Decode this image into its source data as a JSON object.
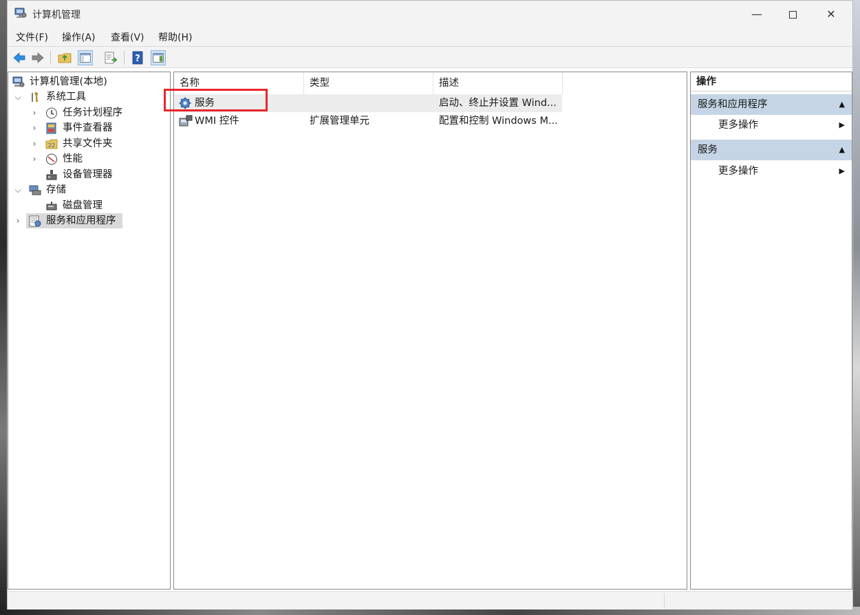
{
  "window": {
    "title": "计算机管理"
  },
  "menu": [
    "文件(F)",
    "操作(A)",
    "查看(V)",
    "帮助(H)"
  ],
  "toolbar": {
    "icons": [
      "back-arrow-icon",
      "forward-arrow-icon",
      "up-folder-icon",
      "show-hide-tree-icon",
      "export-list-icon",
      "help-icon",
      "show-hide-action-pane-icon"
    ]
  },
  "tree": {
    "root": "计算机管理(本地)",
    "system_tools": "系统工具",
    "task_scheduler": "任务计划程序",
    "event_viewer": "事件查看器",
    "shared_folders": "共享文件夹",
    "performance": "性能",
    "device_manager": "设备管理器",
    "storage": "存储",
    "disk_management": "磁盘管理",
    "services_apps": "服务和应用程序"
  },
  "list": {
    "headers": [
      "名称",
      "类型",
      "描述"
    ],
    "rows": [
      {
        "name": "服务",
        "type": "",
        "desc": "启动、终止并设置 Wind..."
      },
      {
        "name": "WMI 控件",
        "type": "扩展管理单元",
        "desc": "配置和控制 Windows M..."
      }
    ]
  },
  "actions": {
    "header": "操作",
    "groups": [
      {
        "title": "服务和应用程序",
        "item": "更多操作"
      },
      {
        "title": "服务",
        "item": "更多操作"
      }
    ]
  },
  "colors": {
    "highlight_box": "#e8262c",
    "action_group_bg": "#c5d5e6",
    "selected_tree_bg": "#d9d9d9"
  }
}
